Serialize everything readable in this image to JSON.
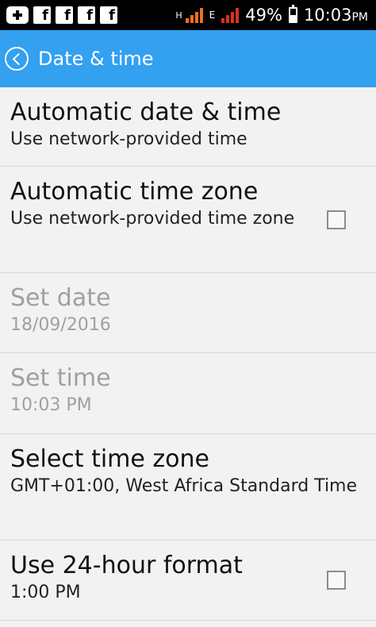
{
  "status_bar": {
    "notification_icons": [
      "add-icon",
      "facebook-icon",
      "facebook-icon",
      "facebook-icon",
      "facebook-icon"
    ],
    "fb_letter": "f",
    "network_type_1": "H",
    "network_type_2": "E",
    "battery": "49%",
    "time": "10:03",
    "ampm": "PM",
    "colors": {
      "signal_1": "#e8711d",
      "signal_2": "#d6321f"
    }
  },
  "app_bar": {
    "title": "Date & time",
    "color": "#33a0f0"
  },
  "settings": [
    {
      "title": "Automatic date & time",
      "summary": "Use network-provided time",
      "enabled": true,
      "has_checkbox": false
    },
    {
      "title": "Automatic time zone",
      "summary": "Use network-provided time zone",
      "enabled": true,
      "has_checkbox": true,
      "checked": false
    },
    {
      "title": "Set date",
      "summary": "18/09/2016",
      "enabled": false,
      "has_checkbox": false
    },
    {
      "title": "Set time",
      "summary": "10:03 PM",
      "enabled": false,
      "has_checkbox": false
    },
    {
      "title": "Select time zone",
      "summary": "GMT+01:00, West Africa Standard Time",
      "enabled": true,
      "has_checkbox": false
    },
    {
      "title": "Use 24-hour format",
      "summary": "1:00 PM",
      "enabled": true,
      "has_checkbox": true,
      "checked": false
    }
  ]
}
